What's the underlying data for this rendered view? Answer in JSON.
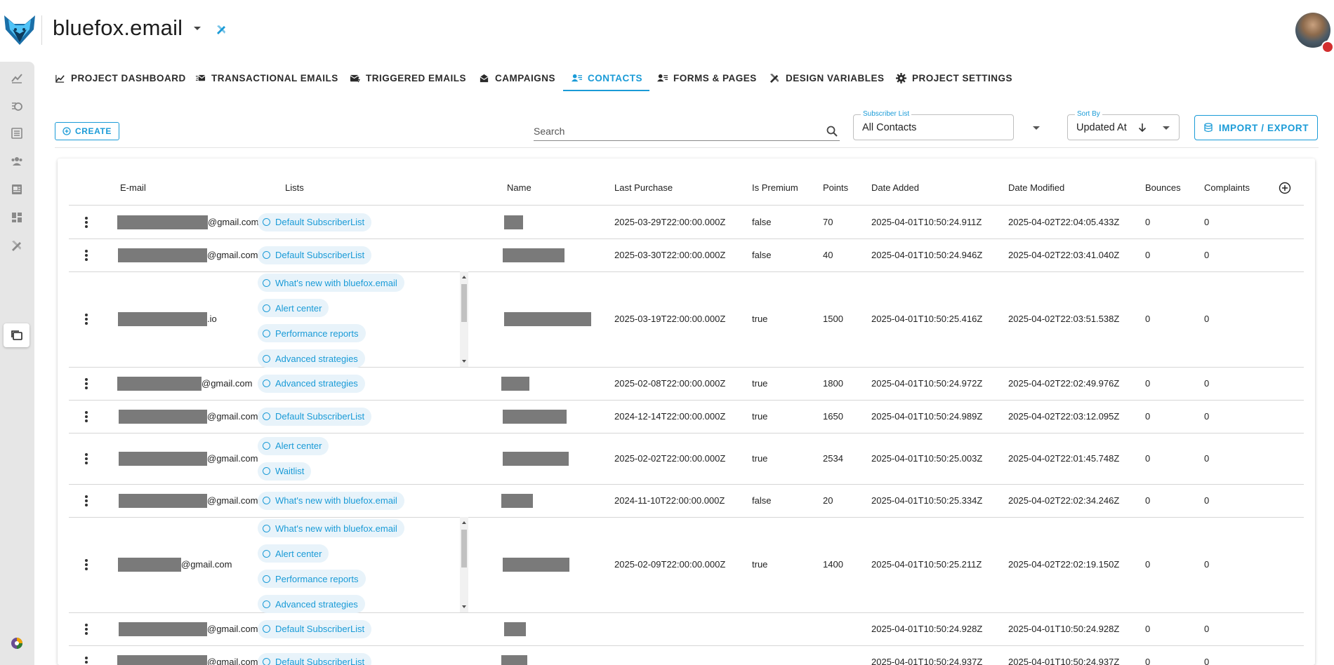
{
  "app": {
    "project_name": "bluefox.email",
    "colors": {
      "accent": "#1a9bd7",
      "chip_bg": "#e8f3fa",
      "sidebar_bg": "#e6e6e6",
      "redacted": "#7a7a7a"
    }
  },
  "sidebar": {
    "items": [
      {
        "icon": "chart-line-icon"
      },
      {
        "icon": "email-clock-icon"
      },
      {
        "icon": "list-box-icon"
      },
      {
        "icon": "contacts-group-icon"
      },
      {
        "icon": "form-page-icon"
      },
      {
        "icon": "dashboard-grid-icon"
      },
      {
        "icon": "design-tools-icon"
      },
      {
        "icon": "projects-folder-icon",
        "active": true
      }
    ]
  },
  "tabs": [
    {
      "label": "PROJECT DASHBOARD",
      "icon": "chart-line-icon"
    },
    {
      "label": "TRANSACTIONAL EMAILS",
      "icon": "email-fast-icon"
    },
    {
      "label": "TRIGGERED EMAILS",
      "icon": "email-lightning-icon"
    },
    {
      "label": "CAMPAIGNS",
      "icon": "email-open-icon"
    },
    {
      "label": "CONTACTS",
      "icon": "contacts-list-icon",
      "active": true
    },
    {
      "label": "FORMS & PAGES",
      "icon": "forms-icon"
    },
    {
      "label": "DESIGN VARIABLES",
      "icon": "design-tools-icon"
    },
    {
      "label": "PROJECT SETTINGS",
      "icon": "gear-icon"
    }
  ],
  "toolbar": {
    "create_label": "CREATE",
    "search_placeholder": "Search",
    "subscriber_list_label": "Subscriber List",
    "subscriber_list_value": "All Contacts",
    "sort_label": "Sort By",
    "sort_value": "Updated At",
    "import_export_label": "IMPORT / EXPORT"
  },
  "table": {
    "columns": {
      "email": "E-mail",
      "lists": "Lists",
      "name": "Name",
      "last_purchase": "Last Purchase",
      "is_premium": "Is Premium",
      "points": "Points",
      "date_added": "Date Added",
      "date_modified": "Date Modified",
      "bounces": "Bounces",
      "complaints": "Complaints"
    },
    "rows": [
      {
        "email_suffix": "@gmail.com",
        "lists": [
          "Default SubscriberList"
        ],
        "last_purchase": "2025-03-29T22:00:00.000Z",
        "is_premium": "false",
        "points": "70",
        "date_added": "2025-04-01T10:50:24.911Z",
        "date_modified": "2025-04-02T22:04:05.433Z",
        "bounces": "0",
        "complaints": "0"
      },
      {
        "email_suffix": "@gmail.com",
        "lists": [
          "Default SubscriberList"
        ],
        "last_purchase": "2025-03-30T22:00:00.000Z",
        "is_premium": "false",
        "points": "40",
        "date_added": "2025-04-01T10:50:24.946Z",
        "date_modified": "2025-04-02T22:03:41.040Z",
        "bounces": "0",
        "complaints": "0"
      },
      {
        "email_suffix": ".io",
        "lists": [
          "What's new with bluefox.email",
          "Alert center",
          "Performance reports",
          "Advanced strategies"
        ],
        "last_purchase": "2025-03-19T22:00:00.000Z",
        "is_premium": "true",
        "points": "1500",
        "date_added": "2025-04-01T10:50:25.416Z",
        "date_modified": "2025-04-02T22:03:51.538Z",
        "bounces": "0",
        "complaints": "0"
      },
      {
        "email_suffix": "@gmail.com",
        "lists": [
          "Advanced strategies"
        ],
        "last_purchase": "2025-02-08T22:00:00.000Z",
        "is_premium": "true",
        "points": "1800",
        "date_added": "2025-04-01T10:50:24.972Z",
        "date_modified": "2025-04-02T22:02:49.976Z",
        "bounces": "0",
        "complaints": "0"
      },
      {
        "email_suffix": "@gmail.com",
        "lists": [
          "Default SubscriberList"
        ],
        "last_purchase": "2024-12-14T22:00:00.000Z",
        "is_premium": "true",
        "points": "1650",
        "date_added": "2025-04-01T10:50:24.989Z",
        "date_modified": "2025-04-02T22:03:12.095Z",
        "bounces": "0",
        "complaints": "0"
      },
      {
        "email_suffix": "@gmail.com",
        "lists": [
          "Alert center",
          "Waitlist"
        ],
        "last_purchase": "2025-02-02T22:00:00.000Z",
        "is_premium": "true",
        "points": "2534",
        "date_added": "2025-04-01T10:50:25.003Z",
        "date_modified": "2025-04-02T22:01:45.748Z",
        "bounces": "0",
        "complaints": "0"
      },
      {
        "email_suffix": "@gmail.com",
        "lists": [
          "What's new with bluefox.email"
        ],
        "last_purchase": "2024-11-10T22:00:00.000Z",
        "is_premium": "false",
        "points": "20",
        "date_added": "2025-04-01T10:50:25.334Z",
        "date_modified": "2025-04-02T22:02:34.246Z",
        "bounces": "0",
        "complaints": "0"
      },
      {
        "email_suffix": "@gmail.com",
        "lists": [
          "What's new with bluefox.email",
          "Alert center",
          "Performance reports",
          "Advanced strategies"
        ],
        "last_purchase": "2025-02-09T22:00:00.000Z",
        "is_premium": "true",
        "points": "1400",
        "date_added": "2025-04-01T10:50:25.211Z",
        "date_modified": "2025-04-02T22:02:19.150Z",
        "bounces": "0",
        "complaints": "0"
      },
      {
        "email_suffix": "@gmail.com",
        "lists": [
          "Default SubscriberList"
        ],
        "last_purchase": "",
        "is_premium": "",
        "points": "",
        "date_added": "2025-04-01T10:50:24.928Z",
        "date_modified": "2025-04-01T10:50:24.928Z",
        "bounces": "0",
        "complaints": "0"
      },
      {
        "email_suffix": "@gmail.com",
        "lists": [
          "Default SubscriberList"
        ],
        "last_purchase": "",
        "is_premium": "",
        "points": "",
        "date_added": "2025-04-01T10:50:24.937Z",
        "date_modified": "2025-04-01T10:50:24.937Z",
        "bounces": "0",
        "complaints": "0"
      }
    ]
  }
}
